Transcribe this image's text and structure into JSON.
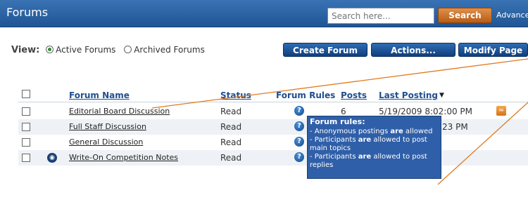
{
  "header": {
    "title": "Forums",
    "search_placeholder": "Search here...",
    "search_label": "Search",
    "advanced_label": "Advance"
  },
  "view": {
    "label": "View:",
    "active": "Active Forums",
    "archived": "Archived Forums",
    "selected": "Active Forums"
  },
  "buttons": {
    "create": "Create Forum",
    "actions": "Actions...",
    "modify": "Modify Page"
  },
  "table": {
    "headers": {
      "name": "Forum Name",
      "status": "Status",
      "rules": "Forum Rules",
      "posts": "Posts",
      "last": "Last Posting",
      "sort_arrow": "▼"
    },
    "rows": [
      {
        "name": "Editorial Board Discussion",
        "status": "Read",
        "posts": "6",
        "last": "5/19/2009 8:02:00 PM"
      },
      {
        "name": "Full Staff Discussion",
        "status": "Read",
        "posts": "",
        "last": "23 PM"
      },
      {
        "name": "General Discussion",
        "status": "Read",
        "posts": "",
        "last": ""
      },
      {
        "name": "Write-On Competition Notes",
        "status": "Read",
        "posts": "",
        "last": ""
      }
    ]
  },
  "tooltip": {
    "title": "Forum rules:",
    "line1_a": "- Anonymous postings ",
    "line1_b": "are",
    "line1_c": " allowed",
    "line2_a": "- Participants ",
    "line2_b": "are",
    "line2_c": " allowed to post main topics",
    "line3_a": "- Participants ",
    "line3_b": "are",
    "line3_c": " allowed to post replies"
  },
  "colors": {
    "header": "#2a65a8",
    "search_button": "#c86f25",
    "action_button": "#1d5699",
    "annotation_line": "#e07a1c",
    "tooltip": "#2f5fa8"
  },
  "icons": [
    "help-icon",
    "lock-icon",
    "rss-icon",
    "radio-icon",
    "checkbox-icon",
    "sort-arrow-icon"
  ]
}
